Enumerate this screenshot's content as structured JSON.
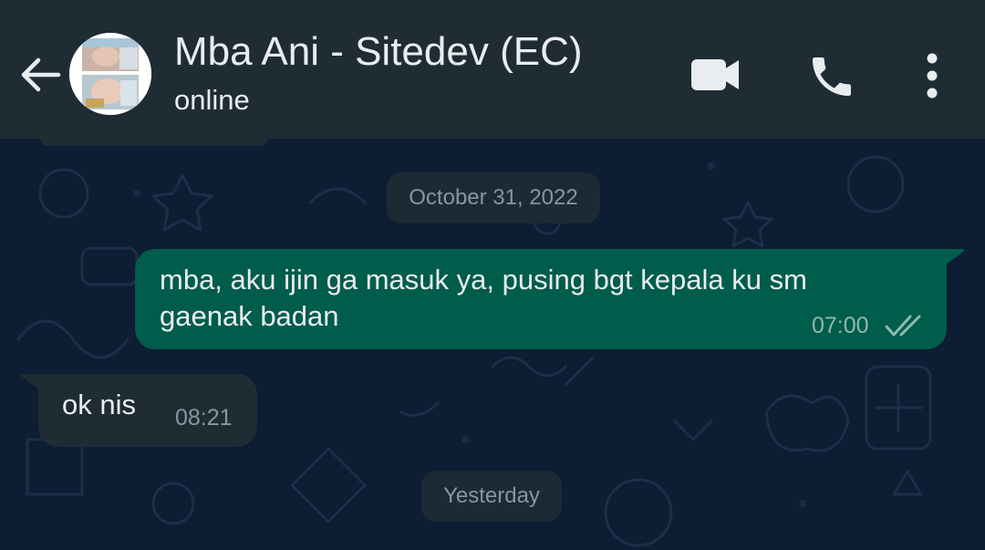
{
  "header": {
    "contact_name": "Mba Ani - Sitedev (EC)",
    "status": "online",
    "icons": [
      "back-arrow-icon",
      "video-call-icon",
      "phone-icon",
      "more-vert-icon"
    ]
  },
  "chat": {
    "date_separators": [
      "October 31, 2022",
      "Yesterday"
    ],
    "messages": [
      {
        "direction": "outgoing",
        "text": "mba, aku ijin ga masuk ya, pusing bgt kepala ku sm gaenak badan",
        "time": "07:00",
        "status_icon": "double-check-icon"
      },
      {
        "direction": "incoming",
        "text": "ok nis",
        "time": "08:21"
      }
    ]
  },
  "colors": {
    "header_bg": "#1f2c34",
    "chat_bg": "#0d1d33",
    "outgoing_bubble": "#005c4b",
    "incoming_bubble": "#1f2c34",
    "text_primary": "#e9edef",
    "text_secondary": "#8696a0"
  }
}
